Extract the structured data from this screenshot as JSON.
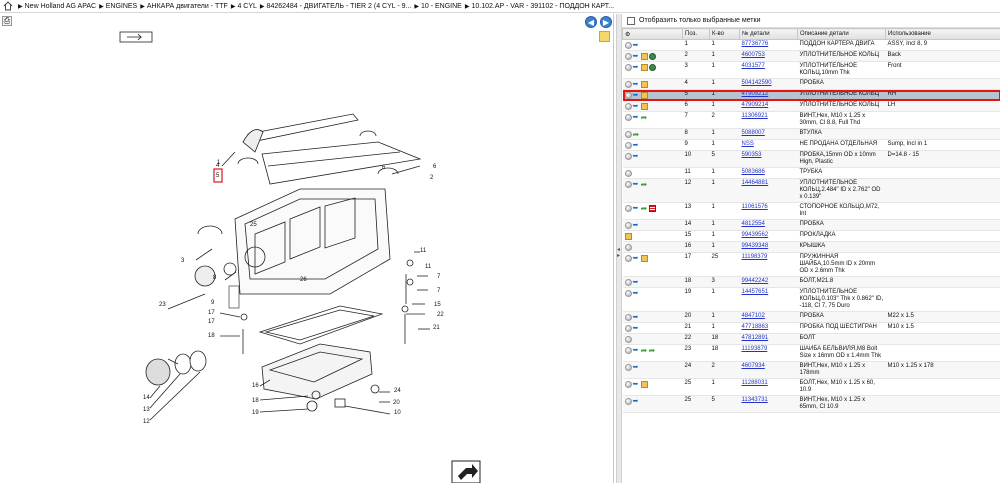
{
  "breadcrumb": {
    "items": [
      "New Holland AG APAC",
      "ENGINES",
      "АНКАРА двигатели - TTF",
      "4 CYL",
      "84262484 - ДВИГАТЕЛЬ - TIER 2 (4 CYL - 9...",
      "10 - ENGINE",
      "10.102.AP - VAR - 391102 - ПОДДОН КАРТ..."
    ]
  },
  "diagram": {
    "callouts": [
      "1",
      "2",
      "3",
      "4",
      "5",
      "6",
      "6",
      "7",
      "7",
      "8",
      "9",
      "10",
      "11",
      "11",
      "12",
      "13",
      "14",
      "15",
      "16",
      "17",
      "17",
      "18",
      "18",
      "19",
      "20",
      "21",
      "22",
      "23",
      "24",
      "25",
      "26"
    ]
  },
  "filter": {
    "label": "Отобразить только выбранные метки"
  },
  "table": {
    "columns": [
      "Поз.",
      "К-во",
      "№ детали",
      "Описание детали",
      "Использование"
    ],
    "rows": [
      {
        "pos": "1",
        "qty": "1",
        "part": "87736776",
        "desc": "ПОДДОН КАРТЕРА ДВИГА",
        "usage": "ASSY, Incl 8, 9",
        "icons": [
          "dot",
          "arrow"
        ]
      },
      {
        "pos": "2",
        "qty": "1",
        "part": "4600753",
        "desc": "УПЛОТНИТЕЛЬНОЕ КОЛЬЦ",
        "usage": "Back",
        "icons": [
          "dot",
          "arrow",
          "box",
          "globe"
        ]
      },
      {
        "pos": "3",
        "qty": "1",
        "part": "4031577",
        "desc": "УПЛОТНИТЕЛЬНОЕ КОЛЬЦ,10mm Thk",
        "usage": "Front",
        "icons": [
          "dot",
          "arrow",
          "box",
          "globe"
        ]
      },
      {
        "pos": "4",
        "qty": "1",
        "part": "504142590",
        "desc": "ПРОБКА",
        "usage": "",
        "icons": [
          "dot",
          "arrow",
          "box"
        ]
      },
      {
        "pos": "5",
        "qty": "1",
        "part": "47909212",
        "desc": "УПЛОТНИТЕЛЬНОЕ КОЛЬЦ",
        "usage": "RH",
        "icons": [
          "dot",
          "arrow",
          "box"
        ],
        "selected": true
      },
      {
        "pos": "6",
        "qty": "1",
        "part": "47909214",
        "desc": "УПЛОТНИТЕЛЬНОЕ КОЛЬЦ",
        "usage": "LH",
        "icons": [
          "dot",
          "arrow",
          "box"
        ]
      },
      {
        "pos": "7",
        "qty": "2",
        "part": "11306921",
        "desc": "ВИНТ,Hex, M10 x 1.25 x 30mm, Cl 8.8, Full Thd",
        "usage": "",
        "icons": [
          "dot",
          "arrow",
          "green"
        ]
      },
      {
        "pos": "8",
        "qty": "1",
        "part": "5088007",
        "desc": "ВТУЛКА",
        "usage": "",
        "icons": [
          "dot",
          "green"
        ]
      },
      {
        "pos": "9",
        "qty": "1",
        "part": "NSS",
        "desc": "НЕ ПРОДАНА ОТДЕЛЬНАЯ",
        "usage": "Sump, Incl in 1",
        "icons": [
          "dot",
          "arrow"
        ]
      },
      {
        "pos": "10",
        "qty": "5",
        "part": "590353",
        "desc": "ПРОБКА,15mm OD x 10mm High, Plastic",
        "usage": "D=14.8 - 15",
        "icons": [
          "dot",
          "arrow"
        ]
      },
      {
        "pos": "11",
        "qty": "1",
        "part": "5083686",
        "desc": "ТРУБКА",
        "usage": "",
        "icons": [
          "dot"
        ]
      },
      {
        "pos": "12",
        "qty": "1",
        "part": "14464881",
        "desc": "УПЛОТНИТЕЛЬНОЕ КОЛЬЦ,2.484\" ID x 2.762\" OD x 0.139\"",
        "usage": "",
        "icons": [
          "dot",
          "arrow",
          "green"
        ]
      },
      {
        "pos": "13",
        "qty": "1",
        "part": "11061576",
        "desc": "СТОПОРНОЕ КОЛЬЦО,M72, Int",
        "usage": "",
        "icons": [
          "dot",
          "arrow",
          "green",
          "red"
        ]
      },
      {
        "pos": "14",
        "qty": "1",
        "part": "4812554",
        "desc": "ПРОБКА",
        "usage": "",
        "icons": [
          "dot",
          "arrow"
        ]
      },
      {
        "pos": "15",
        "qty": "1",
        "part": "99439562",
        "desc": "ПРОКЛАДКА",
        "usage": "",
        "icons": [
          "box"
        ]
      },
      {
        "pos": "16",
        "qty": "1",
        "part": "99439348",
        "desc": "КРЫШКА",
        "usage": "",
        "icons": [
          "dot"
        ]
      },
      {
        "pos": "17",
        "qty": "25",
        "part": "11198379",
        "desc": "ПРУЖИННАЯ ШАЙБА,10.5mm ID x 20mm OD x 2.6mm Thk",
        "usage": "",
        "icons": [
          "dot",
          "arrow",
          "box"
        ]
      },
      {
        "pos": "18",
        "qty": "3",
        "part": "99442242",
        "desc": "БОЛТ,M21.8",
        "usage": "",
        "icons": [
          "dot",
          "arrow"
        ]
      },
      {
        "pos": "19",
        "qty": "1",
        "part": "14457651",
        "desc": "УПЛОТНИТЕЛЬНОЕ КОЛЬЦ,0.103\" Thk x 0.862\" ID, -118, Cl 7, 75 Duro",
        "usage": "",
        "icons": [
          "dot",
          "arrow"
        ]
      },
      {
        "pos": "20",
        "qty": "1",
        "part": "4847102",
        "desc": "ПРОБКА",
        "usage": "M22 x 1.5",
        "icons": [
          "dot",
          "arrow"
        ]
      },
      {
        "pos": "21",
        "qty": "1",
        "part": "47718863",
        "desc": "ПРОБКА ПОД ШЕСТИГРАН",
        "usage": "M10 x 1.5",
        "icons": [
          "dot",
          "arrow"
        ]
      },
      {
        "pos": "22",
        "qty": "18",
        "part": "47812891",
        "desc": "БОЛТ",
        "usage": "",
        "icons": [
          "dot"
        ]
      },
      {
        "pos": "23",
        "qty": "18",
        "part": "11193879",
        "desc": "ШАЙБА БЕЛЬВИЛЯ,M8 Bolt Size x 16mm OD x 1.4mm Thk",
        "usage": "",
        "icons": [
          "dot",
          "arrow",
          "green",
          "green"
        ]
      },
      {
        "pos": "24",
        "qty": "2",
        "part": "4607934",
        "desc": "ВИНТ,Hex, M10 x 1.25 x 178mm",
        "usage": "M10 x 1.25 x 178",
        "icons": [
          "dot",
          "arrow"
        ]
      },
      {
        "pos": "25",
        "qty": "1",
        "part": "11288031",
        "desc": "БОЛТ,Hex, M10 x 1.25 x 60, 10.9",
        "usage": "",
        "icons": [
          "dot",
          "arrow",
          "box"
        ]
      },
      {
        "pos": "25",
        "qty": "5",
        "part": "11343731",
        "desc": "ВИНТ,Hex, M10 x 1.25 x 65mm, Cl 10.9",
        "usage": "",
        "icons": [
          "dot",
          "arrow"
        ]
      }
    ]
  },
  "colors": {
    "selected_row": "#b8c3cf",
    "highlight": "#e01616",
    "link": "#2233cc"
  }
}
